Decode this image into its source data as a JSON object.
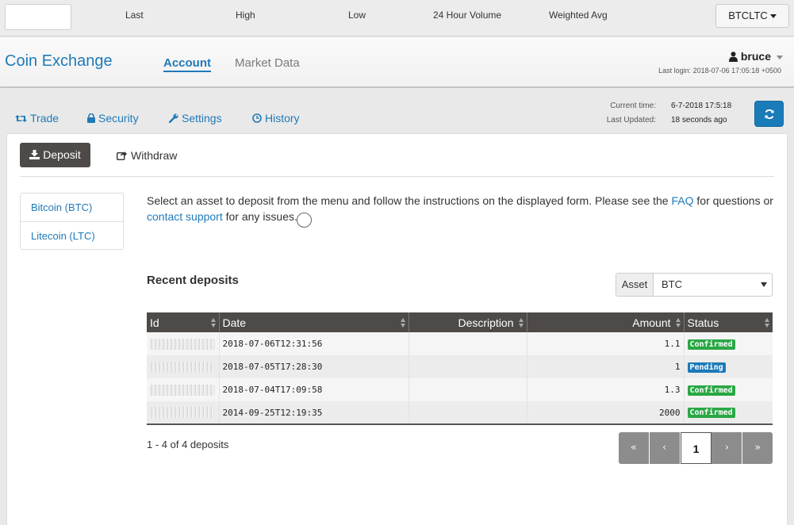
{
  "ticker": {
    "labels": [
      "Last",
      "High",
      "Low",
      "24 Hour Volume",
      "Weighted Avg"
    ],
    "market": "BTCLTC"
  },
  "navbar": {
    "brand": "Coin Exchange",
    "tabs": [
      {
        "label": "Account",
        "active": true
      },
      {
        "label": "Market Data",
        "active": false
      }
    ],
    "user": "bruce",
    "last_login": "Last login: 2018-07-06 17:05:18 +0500"
  },
  "subnav": {
    "items": [
      {
        "label": "Trade",
        "icon": "retweet-icon"
      },
      {
        "label": "Security",
        "icon": "lock-icon"
      },
      {
        "label": "Settings",
        "icon": "wrench-icon"
      },
      {
        "label": "History",
        "icon": "clock-icon"
      }
    ],
    "current_time_label": "Current time:",
    "current_time": "6-7-2018 17:5:18",
    "last_updated_label": "Last Updated:",
    "last_updated": "18 seconds ago"
  },
  "panel": {
    "deposit_tab": "Deposit",
    "withdraw_tab": "Withdraw",
    "assets": [
      "Bitcoin (BTC)",
      "Litecoin (LTC)"
    ],
    "intro_pre": "Select an asset to deposit from the menu and follow the instructions on the displayed form. Please see the ",
    "intro_faq": "FAQ",
    "intro_mid": " for questions or ",
    "intro_support": "contact support",
    "intro_post": " for any issues.",
    "recent_title": "Recent deposits",
    "asset_filter_label": "Asset",
    "asset_filter_value": "BTC"
  },
  "table": {
    "headers": [
      "Id",
      "Date",
      "Description",
      "Amount",
      "Status"
    ],
    "rows": [
      {
        "date": "2018-07-06T12:31:56",
        "description": "",
        "amount": "1.1",
        "status": "Confirmed"
      },
      {
        "date": "2018-07-05T17:28:30",
        "description": "",
        "amount": "1",
        "status": "Pending"
      },
      {
        "date": "2018-07-04T17:09:58",
        "description": "",
        "amount": "1.3",
        "status": "Confirmed"
      },
      {
        "date": "2014-09-25T12:19:35",
        "description": "",
        "amount": "2000",
        "status": "Confirmed"
      }
    ],
    "status_colors": {
      "Confirmed": "#2aa745",
      "Pending": "#1b7ab9"
    }
  },
  "pagination": {
    "summary": "1 - 4 of 4 deposits",
    "buttons": [
      "«",
      "‹",
      "1",
      "›",
      "»"
    ],
    "current": "1"
  },
  "colors": {
    "accent": "#1f7ab8",
    "dark_button": "#4e4a47"
  }
}
